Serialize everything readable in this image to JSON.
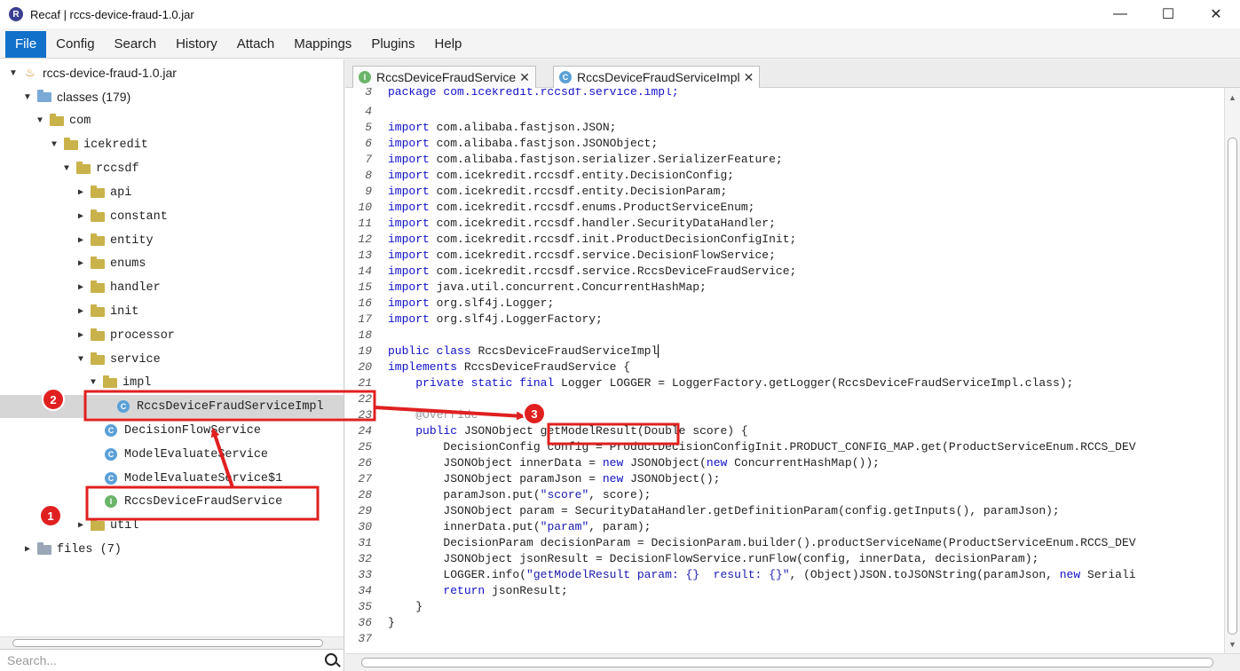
{
  "window": {
    "title": "Recaf | rccs-device-fraud-1.0.jar",
    "minimize": "—",
    "maximize": "☐",
    "close": "✕"
  },
  "menu": [
    "File",
    "Config",
    "Search",
    "History",
    "Attach",
    "Mappings",
    "Plugins",
    "Help"
  ],
  "tree": {
    "root": "rccs-device-fraud-1.0.jar",
    "classes": "classes (179)",
    "com": "com",
    "icekredit": "icekredit",
    "rccsdf": "rccsdf",
    "api": "api",
    "constant": "constant",
    "entity": "entity",
    "enums": "enums",
    "handler": "handler",
    "init": "init",
    "processor": "processor",
    "service": "service",
    "impl": "impl",
    "impl_class": "RccsDeviceFraudServiceImpl",
    "decision_flow": "DecisionFlowService",
    "model_evaluate": "ModelEvaluateService",
    "model_evaluate_1": "ModelEvaluateService$1",
    "rccs_service": "RccsDeviceFraudService",
    "util": "util",
    "files": "files (7)"
  },
  "search": {
    "placeholder": "Search..."
  },
  "tabs": [
    {
      "label": "RccsDeviceFraudService",
      "icon": "I"
    },
    {
      "label": "RccsDeviceFraudServiceImpl",
      "icon": "C"
    }
  ],
  "tab_close": "✕",
  "code": {
    "l3": [
      "package com.icekredit.rccsdf.service.impl;"
    ],
    "l5": "com.alibaba.fastjson.JSON;",
    "l6": "com.alibaba.fastjson.JSONObject;",
    "l7": "com.alibaba.fastjson.serializer.SerializerFeature;",
    "l8": "com.icekredit.rccsdf.entity.DecisionConfig;",
    "l9": "com.icekredit.rccsdf.entity.DecisionParam;",
    "l10": "com.icekredit.rccsdf.enums.ProductServiceEnum;",
    "l11": "com.icekredit.rccsdf.handler.SecurityDataHandler;",
    "l12": "com.icekredit.rccsdf.init.ProductDecisionConfigInit;",
    "l13": "com.icekredit.rccsdf.service.DecisionFlowService;",
    "l14": "com.icekredit.rccsdf.service.RccsDeviceFraudService;",
    "l15": "java.util.concurrent.ConcurrentHashMap;",
    "l16": "org.slf4j.Logger;",
    "l17": "org.slf4j.LoggerFactory;",
    "import_kw": "import",
    "public_class_kw": "public class",
    "class_name": "RccsDeviceFraudServiceImpl",
    "implements_kw": "implements",
    "implements_rest": " RccsDeviceFraudService {",
    "private_static_final_kw": "private static final",
    "l21_rest": " Logger LOGGER = LoggerFactory.getLogger(RccsDeviceFraudServiceImpl.class);",
    "override": "@Override",
    "public_kw": "public",
    "l24_rest": " JSONObject getModelResult(Double score) {",
    "l25": "DecisionConfig config = ProductDecisionConfigInit.PRODUCT_CONFIG_MAP.get(ProductServiceEnum.RCCS_DEV",
    "l26_a": "JSONObject innerData = ",
    "new_kw": "new",
    "l26_b": " JSONObject(",
    "l26_c": " ConcurrentHashMap());",
    "l27_a": "JSONObject paramJson = ",
    "l27_b": " JSONObject();",
    "l28_a": "paramJson.put(",
    "l28_str": "\"score\"",
    "l28_b": ", score);",
    "l29": "JSONObject param = SecurityDataHandler.getDefinitionParam(config.getInputs(), paramJson);",
    "l30_a": "innerData.put(",
    "l30_str": "\"param\"",
    "l30_b": ", param);",
    "l31": "DecisionParam decisionParam = DecisionParam.builder().productServiceName(ProductServiceEnum.RCCS_DEV",
    "l32": "JSONObject jsonResult = DecisionFlowService.runFlow(config, innerData, decisionParam);",
    "l33_a": "LOGGER.info(",
    "l33_str": "\"getModelResult param: {}  result: {}\"",
    "l33_b": ", (Object)JSON.toJSONString(paramJson, ",
    "l33_c": " Seriali",
    "return_kw": "return",
    "l34_rest": " jsonResult;",
    "close_brace": "}"
  },
  "annotations": {
    "badge1": "1",
    "badge2": "2",
    "badge3": "3",
    "color": "#e02020"
  }
}
